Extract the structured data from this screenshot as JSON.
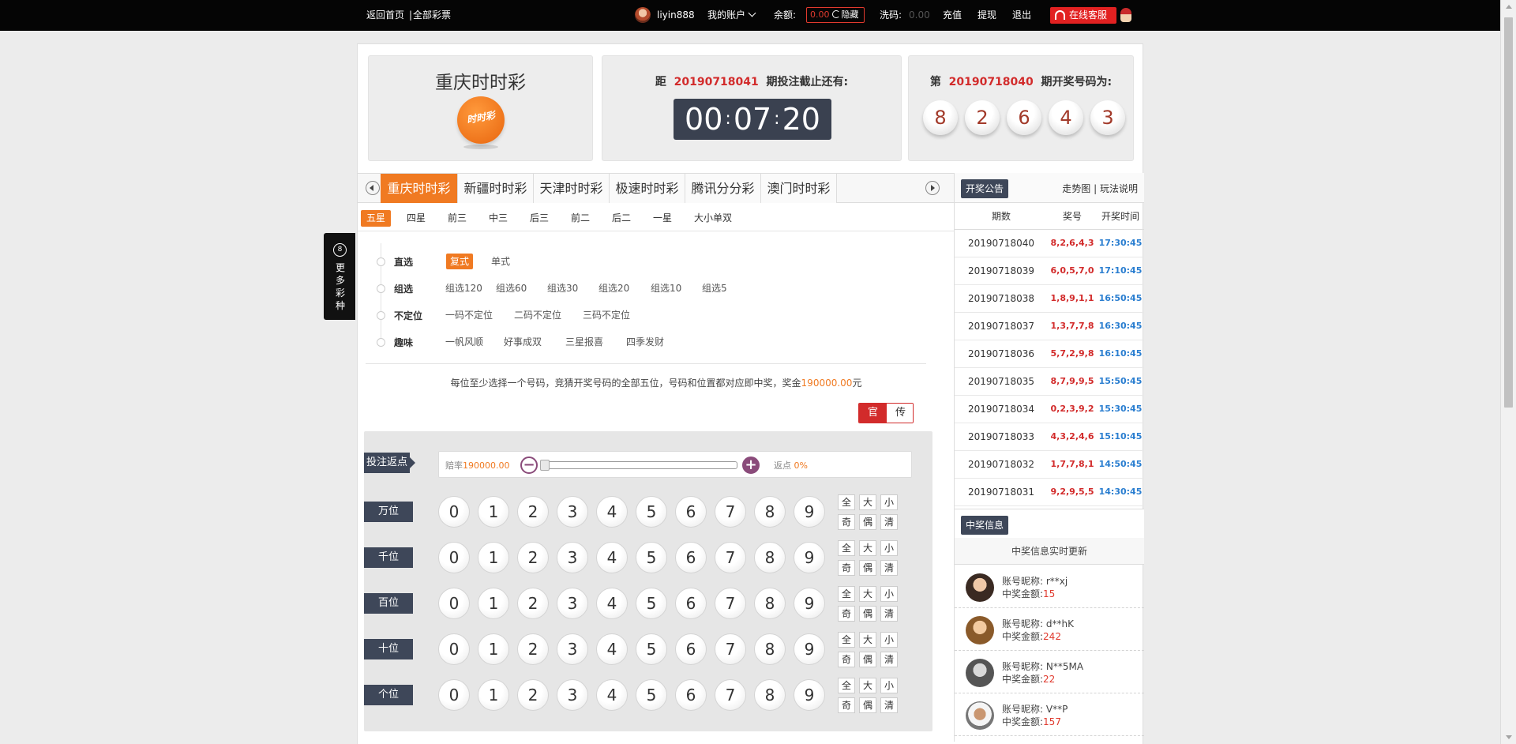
{
  "topbar": {
    "home_link": "返回首页",
    "divider": "|",
    "all_lottery_link": "全部彩票",
    "username": "liyin888",
    "my_account": "我的账户",
    "balance_label": "余额:",
    "balance_value": "0.00",
    "hide_label": "隐藏",
    "wash_label": "洗码:",
    "wash_value": "0.00",
    "recharge": "充值",
    "withdraw": "提现",
    "logout": "退出",
    "online_service": "在线客服"
  },
  "side_tab": {
    "icon_text": "8",
    "label": "更多彩种"
  },
  "lottery": {
    "title": "重庆时时彩",
    "logo_text": "时时彩"
  },
  "countdown": {
    "prefix": "距",
    "issue": "20190718041",
    "suffix": "期投注截止还有:",
    "hours": "00",
    "minutes": "07",
    "seconds": "20",
    "sep": ":"
  },
  "last_result": {
    "prefix": "第",
    "issue": "20190718040",
    "suffix": "期开奖号码为:",
    "numbers": [
      "8",
      "2",
      "6",
      "4",
      "3"
    ]
  },
  "game_tabs": [
    "重庆时时彩",
    "新疆时时彩",
    "天津时时彩",
    "极速时时彩",
    "腾讯分分彩",
    "澳门时时彩"
  ],
  "play_tabs": [
    "五星",
    "四星",
    "前三",
    "中三",
    "后三",
    "前二",
    "后二",
    "一星",
    "大小单双"
  ],
  "sub_rows": [
    {
      "label": "直选",
      "options": [
        "复式",
        "单式"
      ]
    },
    {
      "label": "组选",
      "options": [
        "组选120",
        "组选60",
        "组选30",
        "组选20",
        "组选10",
        "组选5"
      ]
    },
    {
      "label": "不定位",
      "options": [
        "一码不定位",
        "二码不定位",
        "三码不定位"
      ]
    },
    {
      "label": "趣味",
      "options": [
        "一帆风顺",
        "好事成双",
        "三星报喜",
        "四季发财"
      ]
    }
  ],
  "description": {
    "text": "每位至少选择一个号码，竞猜开奖号码的全部五位，号码和位置都对应即中奖，奖金",
    "prize": "190000.00",
    "unit": "元"
  },
  "mode": {
    "official": "官",
    "traditional": "传"
  },
  "rebate": {
    "tag": "投注返点",
    "odds_label": "赔率",
    "odds_value": "190000.00",
    "minus": "−",
    "plus": "+",
    "rebate_label": "返点",
    "rebate_value": "0%",
    "slider_level": 0
  },
  "positions": [
    "万位",
    "千位",
    "百位",
    "十位",
    "个位"
  ],
  "digits": [
    "0",
    "1",
    "2",
    "3",
    "4",
    "5",
    "6",
    "7",
    "8",
    "9"
  ],
  "quick_buttons": [
    "全",
    "大",
    "小",
    "奇",
    "偶",
    "清"
  ],
  "results_panel": {
    "title": "开奖公告",
    "trend_link": "走势图",
    "sep": "|",
    "rules_link": "玩法说明",
    "headers": [
      "期数",
      "奖号",
      "开奖时间"
    ],
    "rows": [
      {
        "issue": "20190718040",
        "numbers": "8,2,6,4,3",
        "time": "17:30:45"
      },
      {
        "issue": "20190718039",
        "numbers": "6,0,5,7,0",
        "time": "17:10:45"
      },
      {
        "issue": "20190718038",
        "numbers": "1,8,9,1,1",
        "time": "16:50:45"
      },
      {
        "issue": "20190718037",
        "numbers": "1,3,7,7,8",
        "time": "16:30:45"
      },
      {
        "issue": "20190718036",
        "numbers": "5,7,2,9,8",
        "time": "16:10:45"
      },
      {
        "issue": "20190718035",
        "numbers": "8,7,9,9,5",
        "time": "15:50:45"
      },
      {
        "issue": "20190718034",
        "numbers": "0,2,3,9,2",
        "time": "15:30:45"
      },
      {
        "issue": "20190718033",
        "numbers": "4,3,2,4,6",
        "time": "15:10:45"
      },
      {
        "issue": "20190718032",
        "numbers": "1,7,7,8,1",
        "time": "14:50:45"
      },
      {
        "issue": "20190718031",
        "numbers": "9,2,9,5,5",
        "time": "14:30:45"
      }
    ]
  },
  "winners_panel": {
    "title": "中奖信息",
    "subtitle": "中奖信息实时更新",
    "name_label": "账号昵称:",
    "amount_label": "中奖金额:",
    "winners": [
      {
        "name": "r**xj",
        "amount": "15"
      },
      {
        "name": "d**hK",
        "amount": "242"
      },
      {
        "name": "N**5MA",
        "amount": "22"
      },
      {
        "name": "V**P",
        "amount": "157"
      }
    ]
  },
  "colors": {
    "accent_orange": "#f07a22",
    "accent_red": "#d22b2b",
    "dark_label": "#3e4759",
    "time_blue": "#2a7ed0"
  }
}
